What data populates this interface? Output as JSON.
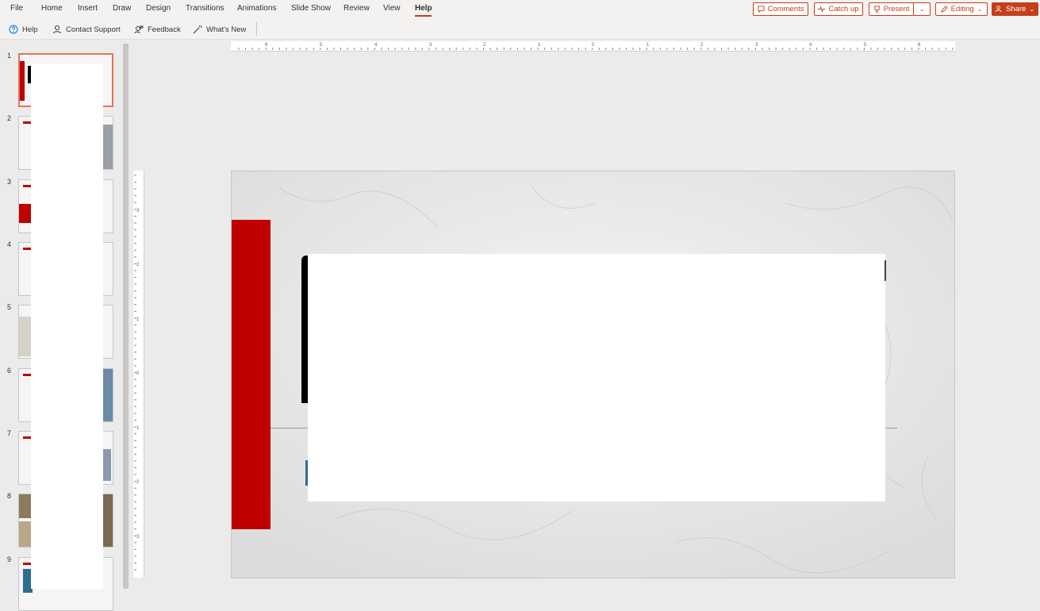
{
  "ribbon": {
    "tabs": [
      "File",
      "Home",
      "Insert",
      "Draw",
      "Design",
      "Transitions",
      "Animations",
      "Slide Show",
      "Review",
      "View",
      "Help"
    ],
    "active_tab": "Help",
    "buttons": {
      "comments": "Comments",
      "catch_up": "Catch up",
      "present": "Present",
      "editing": "Editing",
      "share": "Share"
    }
  },
  "toolbar": {
    "help": "Help",
    "contact_support": "Contact Support",
    "feedback": "Feedback",
    "whats_new": "What's New"
  },
  "thumbnails": [
    "1",
    "2",
    "3",
    "4",
    "5",
    "6",
    "7",
    "8",
    "9"
  ],
  "selected_slide": "1",
  "rulers": {
    "horizontal": [
      "6",
      "5",
      "4",
      "3",
      "2",
      "1",
      "0",
      "1",
      "2",
      "3",
      "4",
      "5",
      "6"
    ],
    "vertical": [
      "3",
      "2",
      "1",
      "0",
      "1",
      "2",
      "3"
    ]
  },
  "colors": {
    "accent": "#c43e1c",
    "slide_red": "#c00000"
  }
}
